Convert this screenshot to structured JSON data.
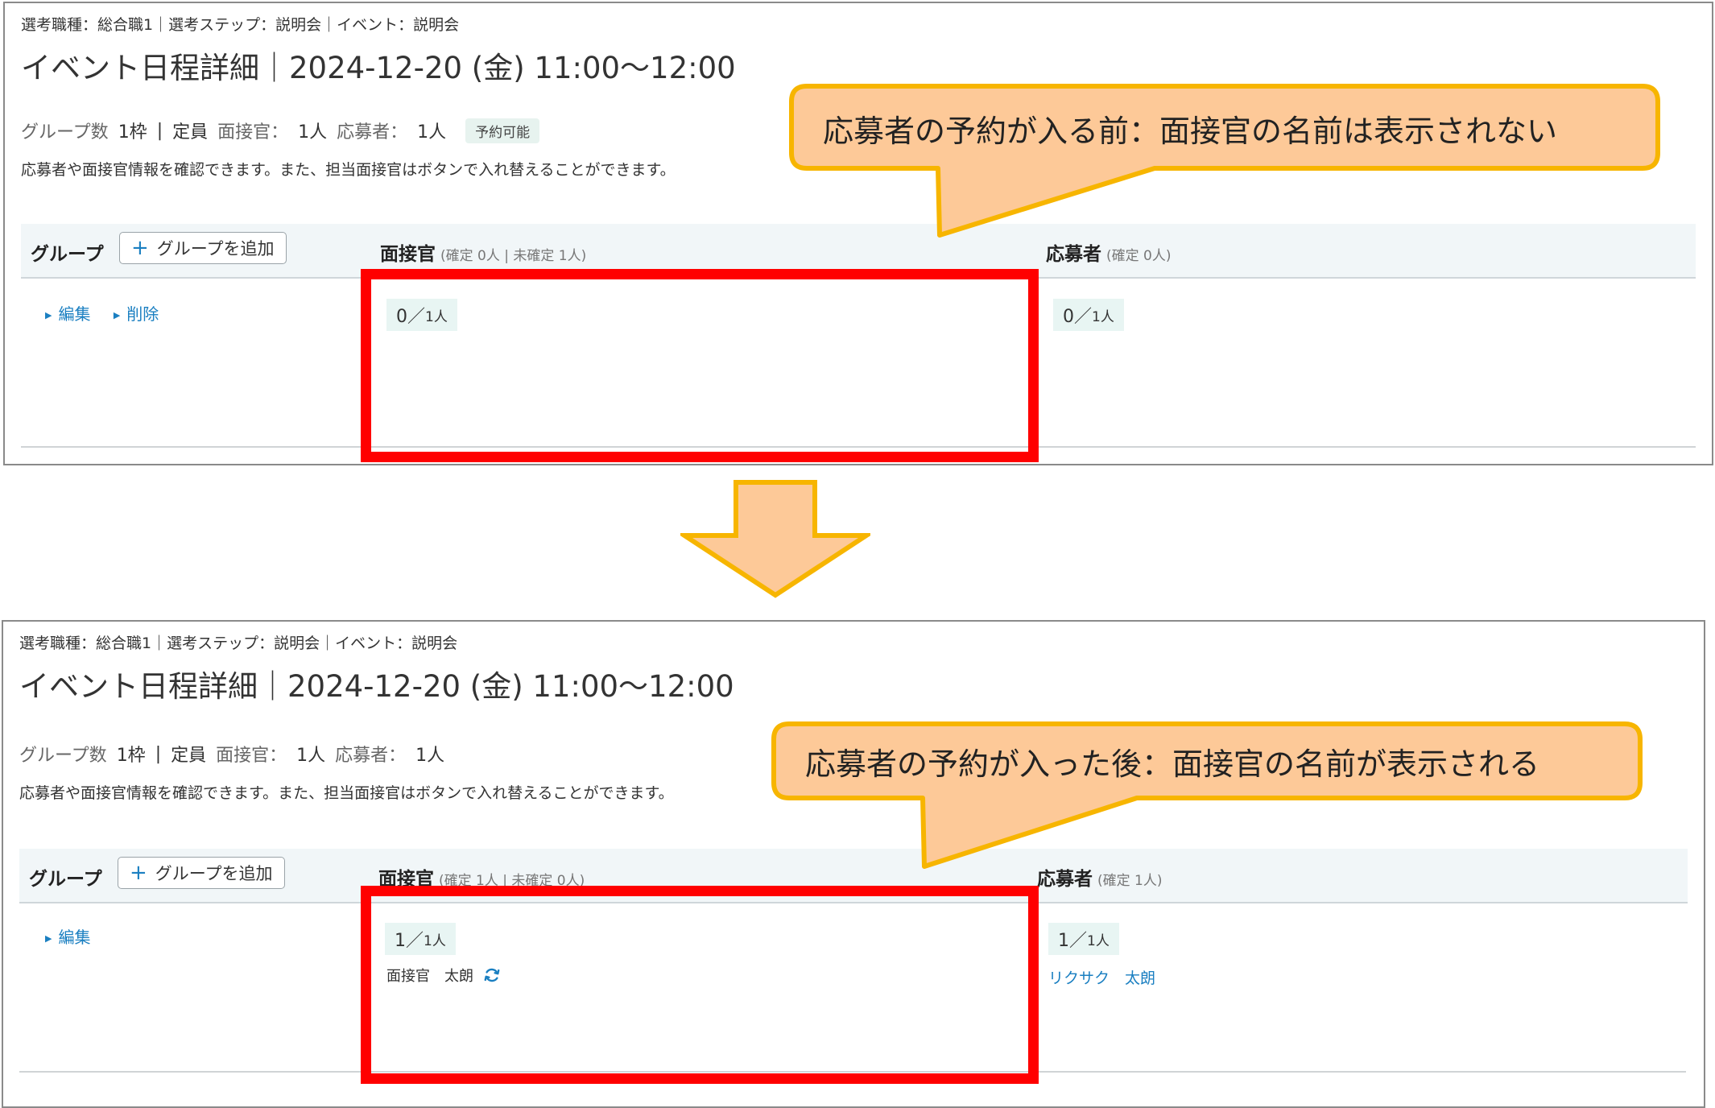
{
  "callouts": {
    "before": "応募者の予約が入る前：面接官の名前は表示されない",
    "after": "応募者の予約が入った後：面接官の名前が表示される"
  },
  "before": {
    "breadcrumb": "選考職種：総合職1｜選考ステップ：説明会｜イベント：説明会",
    "title": "イベント日程詳細｜2024-12-20 (金) 11:00〜12:00",
    "stats": {
      "group_label": "グループ数",
      "group_value": "1枠",
      "sep": "|",
      "capacity_label": "定員",
      "interviewer_label": "面接官：",
      "interviewer_value": "1人",
      "applicant_label": "応募者：",
      "applicant_value": "1人",
      "badge": "予約可能"
    },
    "description": "応募者や面接官情報を確認できます。また、担当面接官はボタンで入れ替えることができます。",
    "table": {
      "group_header": "グループ",
      "add_group": "グループを追加",
      "interviewer_header": "面接官",
      "interviewer_sub": "(確定 0人 | 未確定 1人)",
      "applicant_header": "応募者",
      "applicant_sub": "(確定 0人)",
      "links": [
        "編集",
        "削除"
      ],
      "interviewer_count": "0／",
      "interviewer_count_unit": "1人",
      "applicant_count": "0／",
      "applicant_count_unit": "1人"
    }
  },
  "after": {
    "breadcrumb": "選考職種：総合職1｜選考ステップ：説明会｜イベント：説明会",
    "title": "イベント日程詳細｜2024-12-20 (金) 11:00〜12:00",
    "stats": {
      "group_label": "グループ数",
      "group_value": "1枠",
      "sep": "|",
      "capacity_label": "定員",
      "interviewer_label": "面接官：",
      "interviewer_value": "1人",
      "applicant_label": "応募者：",
      "applicant_value": "1人"
    },
    "description": "応募者や面接官情報を確認できます。また、担当面接官はボタンで入れ替えることができます。",
    "table": {
      "group_header": "グループ",
      "add_group": "グループを追加",
      "interviewer_header": "面接官",
      "interviewer_sub": "(確定 1人 | 未確定 0人)",
      "applicant_header": "応募者",
      "applicant_sub": "(確定 1人)",
      "links": [
        "編集"
      ],
      "interviewer_count": "1／",
      "interviewer_count_unit": "1人",
      "applicant_count": "1／",
      "applicant_count_unit": "1人",
      "interviewer_name": "面接官　太朗",
      "applicant_name": "リクサク　太朗"
    }
  },
  "colors": {
    "highlight": "#ff0000",
    "callout_fill": "#fdc998",
    "callout_border": "#f7b500",
    "link": "#1a7fc1"
  },
  "icons": {
    "swap": "swap-icon",
    "plus": "plus-icon",
    "arrow": "down-arrow-icon"
  }
}
